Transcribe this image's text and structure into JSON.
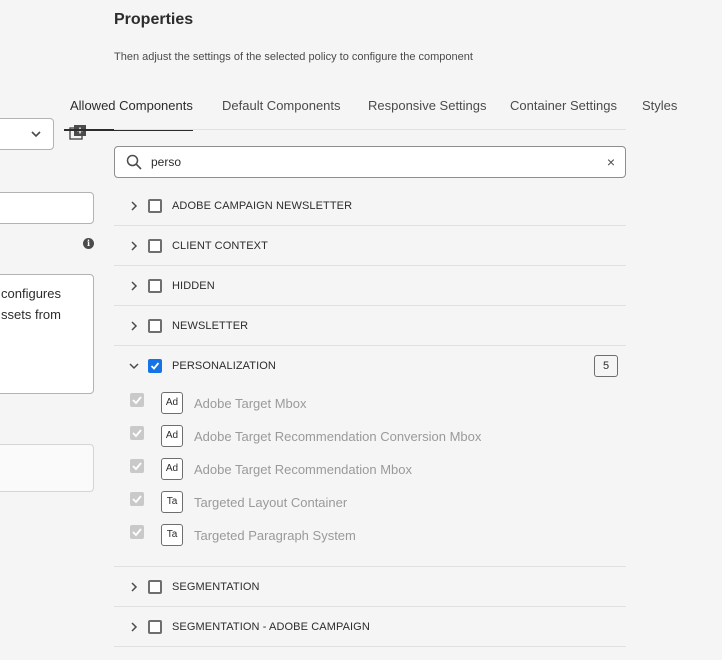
{
  "left_panel": {
    "textarea_lines": [
      "configures",
      "ssets from"
    ]
  },
  "header": {
    "title": "Properties",
    "subtitle": "Then adjust the settings of the selected policy to configure the component"
  },
  "tabs": [
    {
      "label": "Allowed Components",
      "active": true
    },
    {
      "label": "Default Components",
      "active": false
    },
    {
      "label": "Responsive Settings",
      "active": false
    },
    {
      "label": "Container Settings",
      "active": false
    },
    {
      "label": "Styles",
      "active": false
    }
  ],
  "search": {
    "value": "perso",
    "clear_glyph": "×"
  },
  "groups": [
    {
      "label": "ADOBE CAMPAIGN NEWSLETTER",
      "checked": false,
      "expanded": false
    },
    {
      "label": "CLIENT CONTEXT",
      "checked": false,
      "expanded": false
    },
    {
      "label": "HIDDEN",
      "checked": false,
      "expanded": false
    },
    {
      "label": "NEWSLETTER",
      "checked": false,
      "expanded": false
    },
    {
      "label": "PERSONALIZATION",
      "checked": true,
      "expanded": true,
      "count": "5"
    },
    {
      "label": "SEGMENTATION",
      "checked": false,
      "expanded": false
    },
    {
      "label": "SEGMENTATION - ADOBE CAMPAIGN",
      "checked": false,
      "expanded": false
    }
  ],
  "personalization_items": [
    {
      "badge": "Ad",
      "label": "Adobe Target Mbox"
    },
    {
      "badge": "Ad",
      "label": "Adobe Target Recommendation Conversion Mbox"
    },
    {
      "badge": "Ad",
      "label": "Adobe Target Recommendation Mbox"
    },
    {
      "badge": "Ta",
      "label": "Targeted Layout Container"
    },
    {
      "badge": "Ta",
      "label": "Targeted Paragraph System"
    }
  ],
  "colors": {
    "accent": "#1473e6",
    "background": "#f5f5f5",
    "disabled_text": "#9a9a9a"
  },
  "icons": {
    "search": "search-icon",
    "clear": "close-icon",
    "chevron_right": "chevron-right-icon",
    "chevron_down": "chevron-down-icon",
    "info": "info-icon",
    "add": "add-component-icon"
  }
}
